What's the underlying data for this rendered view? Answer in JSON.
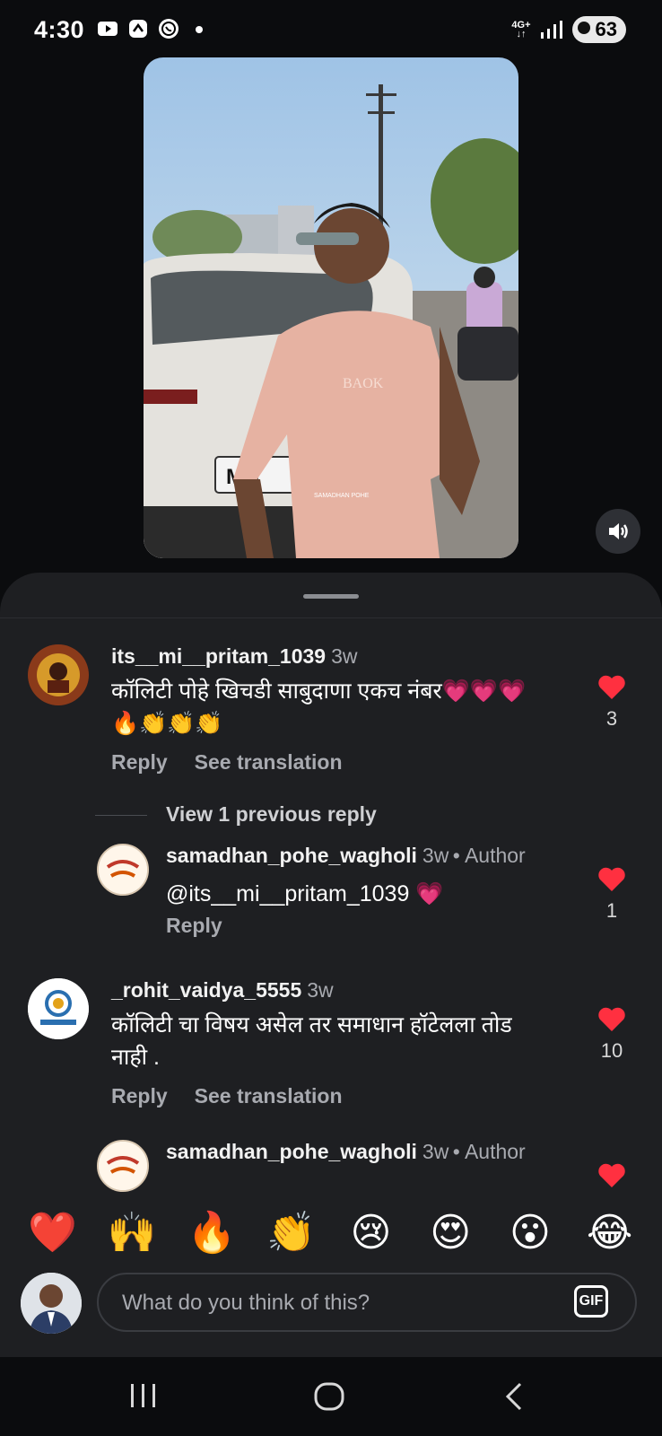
{
  "status_bar": {
    "time": "4:30",
    "network": "4G+",
    "battery": "63",
    "icons": [
      "youtube-icon",
      "app-icon",
      "whatsapp-icon",
      "dot-icon",
      "signal-icon"
    ]
  },
  "video": {
    "watermark": "SAMADHAN POHE",
    "plate_text": "MH",
    "shirt_text": "BAOK"
  },
  "comments": [
    {
      "username": "its__mi__pritam_1039",
      "time": "3w",
      "text_line1": "कॉलिटी पोहे खिचडी साबुदाणा एकच नंबर💗💗💗",
      "text_line2": "🔥👏👏👏",
      "reply": "Reply",
      "see_translation": "See translation",
      "likes": "3"
    },
    {
      "view_replies": "View 1 previous reply"
    },
    {
      "username": "samadhan_pohe_wagholi",
      "time": "3w",
      "author": "• Author",
      "text": "@its__mi__pritam_1039 💗",
      "reply": "Reply",
      "likes": "1"
    },
    {
      "username": "_rohit_vaidya_5555",
      "time": "3w",
      "text_line1": "कॉलिटी चा विषय असेल तर समाधान हॉटेलला  तोड",
      "text_line2": "नाही .",
      "reply": "Reply",
      "see_translation": "See translation",
      "likes": "10"
    },
    {
      "username": "samadhan_pohe_wagholi",
      "time": "3w",
      "author": "• Author"
    }
  ],
  "reactions": [
    "❤️",
    "🙌",
    "🔥",
    "👏",
    "😢",
    "😍",
    "😮",
    "😂"
  ],
  "input": {
    "placeholder": "What do you think of this?",
    "gif_label": "GIF"
  },
  "colors": {
    "background": "#0b0c0e",
    "sheet": "#1e1f22",
    "like_red": "#ff3040",
    "muted": "#a8aab0"
  }
}
